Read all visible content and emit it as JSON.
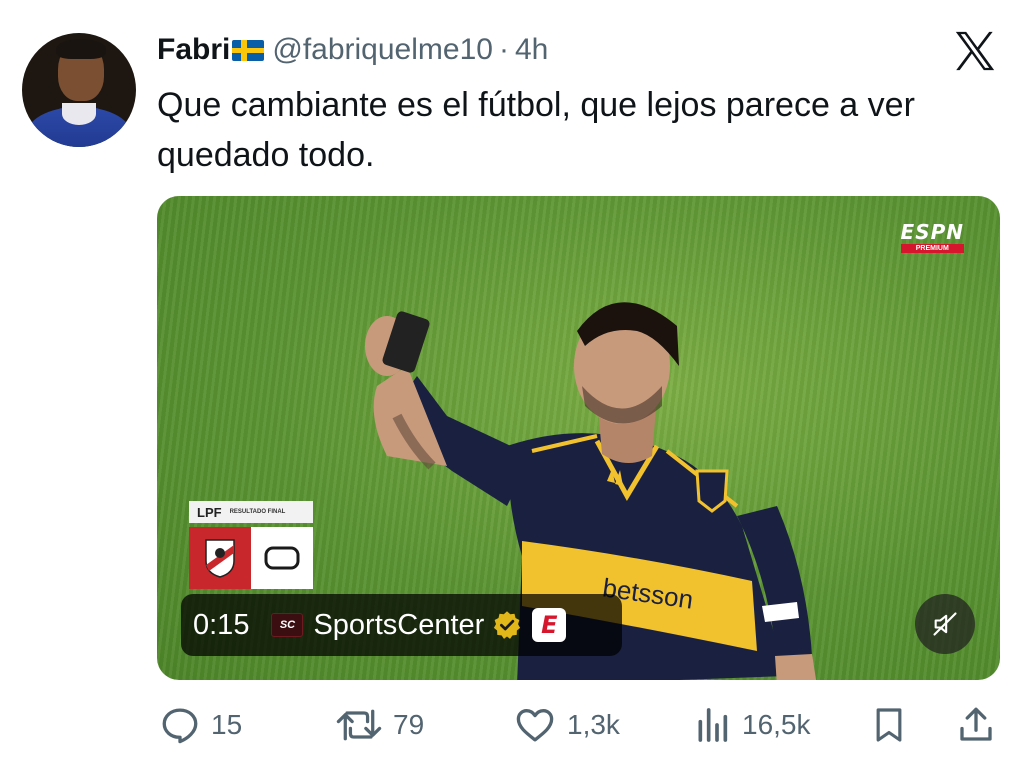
{
  "tweet": {
    "display_name": "Fabri",
    "flag_icon": "sweden-flag-icon",
    "handle": "@fabriquelme10",
    "separator": "·",
    "time": "4h",
    "text": "Que cambiante es el fútbol, que lejos parece a ver quedado todo."
  },
  "media": {
    "broadcaster_logo": "ESPN",
    "broadcaster_sub": "PREMIUM",
    "scorebug": {
      "league": "LPF",
      "label": "RESULTADO FINAL"
    },
    "sponsor_text": "betsson",
    "video": {
      "timestamp": "0:15",
      "channel_badge": "SC",
      "channel_name": "SportsCenter",
      "network_badge": "E"
    }
  },
  "actions": {
    "replies": "15",
    "reposts": "79",
    "likes": "1,3k",
    "views": "16,5k"
  },
  "colors": {
    "text": "#0f1419",
    "secondary": "#536471",
    "espn_red": "#d5162c",
    "boca_yellow": "#f2c12e",
    "boca_navy": "#1a2140"
  }
}
